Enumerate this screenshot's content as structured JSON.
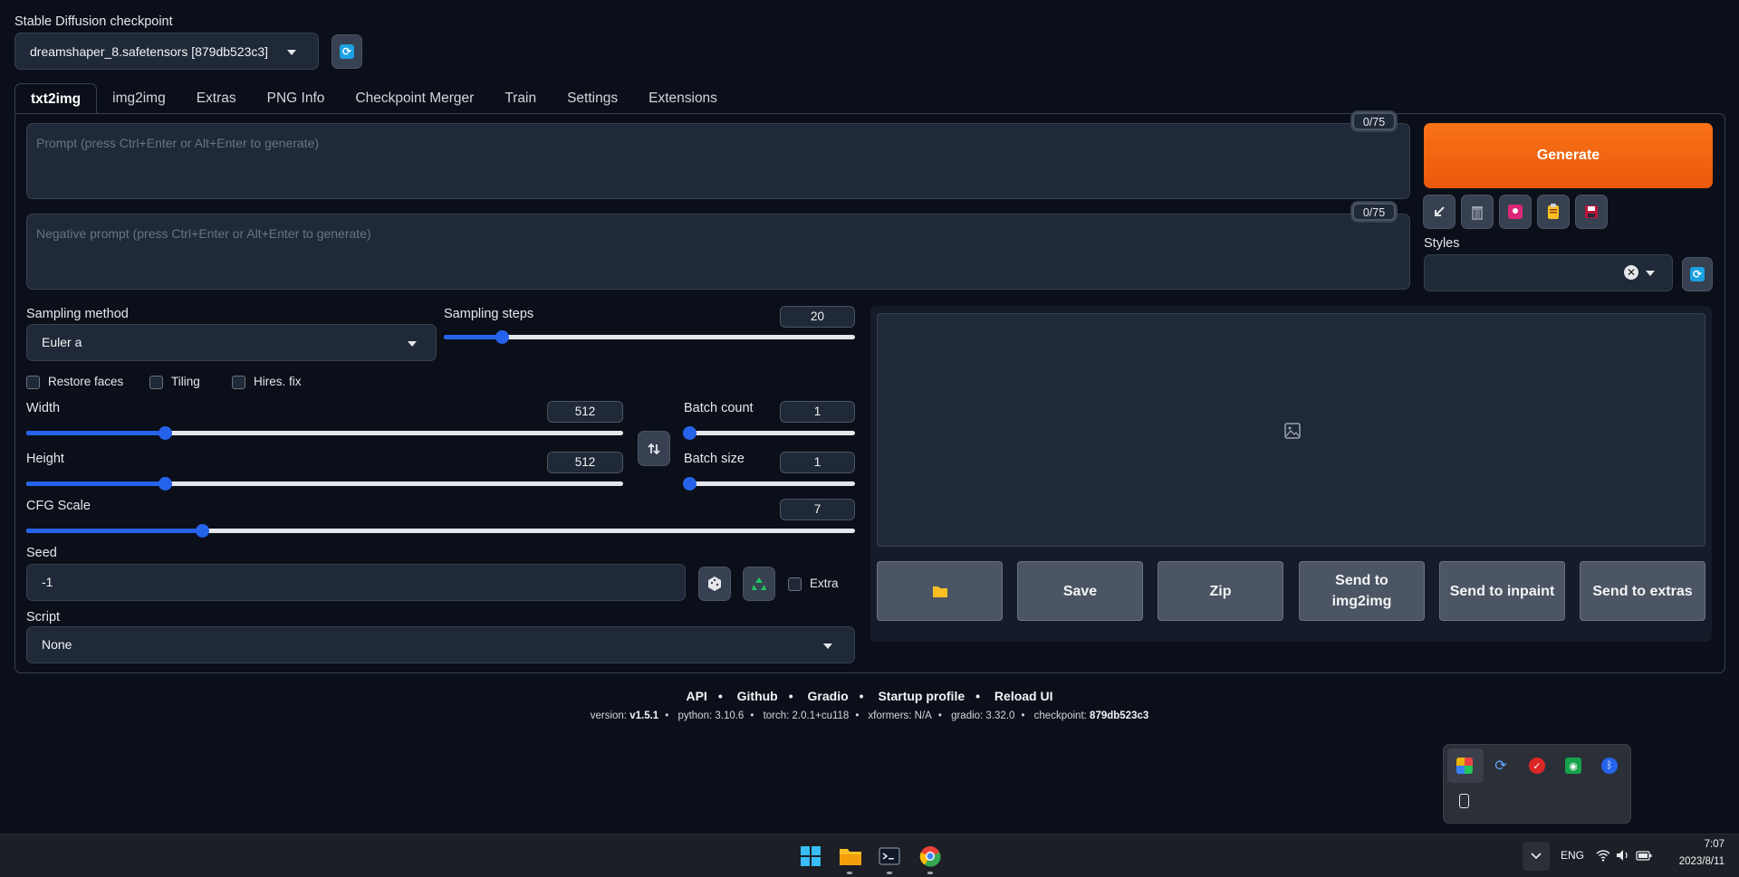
{
  "checkpoint": {
    "label": "Stable Diffusion checkpoint",
    "value": "dreamshaper_8.safetensors [879db523c3]"
  },
  "tabs": [
    "txt2img",
    "img2img",
    "Extras",
    "PNG Info",
    "Checkpoint Merger",
    "Train",
    "Settings",
    "Extensions"
  ],
  "prompt": {
    "placeholder": "Prompt (press Ctrl+Enter or Alt+Enter to generate)",
    "counter": "0/75"
  },
  "negative_prompt": {
    "placeholder": "Negative prompt (press Ctrl+Enter or Alt+Enter to generate)",
    "counter": "0/75"
  },
  "generate_label": "Generate",
  "styles_label": "Styles",
  "sampling": {
    "method_label": "Sampling method",
    "method_value": "Euler a",
    "steps_label": "Sampling steps",
    "steps_value": "20"
  },
  "checkboxes": {
    "restore_faces": "Restore faces",
    "tiling": "Tiling",
    "hires_fix": "Hires. fix"
  },
  "width": {
    "label": "Width",
    "value": "512"
  },
  "height": {
    "label": "Height",
    "value": "512"
  },
  "batch_count": {
    "label": "Batch count",
    "value": "1"
  },
  "batch_size": {
    "label": "Batch size",
    "value": "1"
  },
  "cfg": {
    "label": "CFG Scale",
    "value": "7"
  },
  "seed": {
    "label": "Seed",
    "value": "-1",
    "extra_label": "Extra"
  },
  "script": {
    "label": "Script",
    "value": "None"
  },
  "output_buttons": {
    "save": "Save",
    "zip": "Zip",
    "send_img2img": "Send to img2img",
    "send_inpaint": "Send to inpaint",
    "send_extras": "Send to extras"
  },
  "footer": {
    "links": [
      "API",
      "Github",
      "Gradio",
      "Startup profile",
      "Reload UI"
    ],
    "version_label": "version:",
    "version": "v1.5.1",
    "python": "python: 3.10.6",
    "torch": "torch: 2.0.1+cu118",
    "xformers": "xformers: N/A",
    "gradio": "gradio: 3.32.0",
    "checkpoint_label": "checkpoint:",
    "checkpoint": "879db523c3"
  },
  "taskbar": {
    "lang": "ENG",
    "time": "7:07",
    "date": "2023/8/11"
  },
  "colors": {
    "background": "#0b0f19",
    "accent_orange": "#f97316",
    "slider_blue": "#2563eb"
  }
}
